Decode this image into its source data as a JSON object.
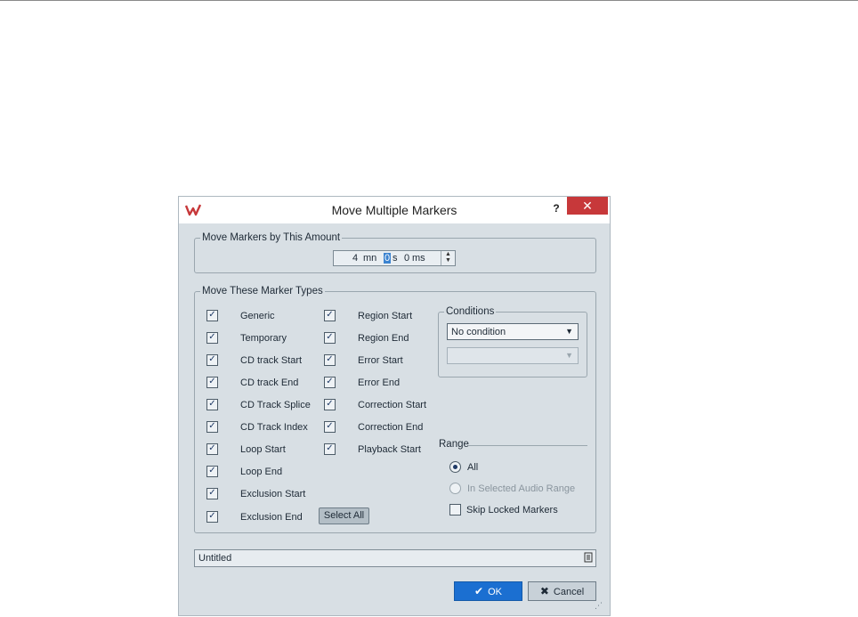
{
  "window": {
    "title": "Move Multiple Markers",
    "help": "?",
    "close": "✕"
  },
  "amount": {
    "legend": "Move Markers by This Amount",
    "minutes": "4",
    "minutes_unit": "mn",
    "seconds": "0",
    "seconds_unit": "s",
    "ms": "0",
    "ms_unit": "ms"
  },
  "types": {
    "legend": "Move These Marker Types",
    "col1": [
      {
        "label": "Generic",
        "checked": true
      },
      {
        "label": "Temporary",
        "checked": true
      },
      {
        "label": "CD track Start",
        "checked": true
      },
      {
        "label": "CD track End",
        "checked": true
      },
      {
        "label": "CD Track Splice",
        "checked": true
      },
      {
        "label": "CD Track Index",
        "checked": true
      },
      {
        "label": "Loop Start",
        "checked": true
      },
      {
        "label": "Loop End",
        "checked": true
      },
      {
        "label": "Exclusion Start",
        "checked": true
      },
      {
        "label": "Exclusion End",
        "checked": true
      }
    ],
    "col2": [
      {
        "label": "Region Start",
        "checked": true
      },
      {
        "label": "Region End",
        "checked": true
      },
      {
        "label": "Error Start",
        "checked": true
      },
      {
        "label": "Error End",
        "checked": true
      },
      {
        "label": "Correction Start",
        "checked": true
      },
      {
        "label": "Correction End",
        "checked": true
      },
      {
        "label": "Playback Start",
        "checked": true
      }
    ],
    "select_all": "Select All",
    "check_glyph": "✓"
  },
  "conditions": {
    "legend": "Conditions",
    "selected": "No condition",
    "second_value": "",
    "arrow": "▼"
  },
  "range": {
    "label": "Range",
    "options": [
      {
        "label": "All",
        "selected": true,
        "enabled": true
      },
      {
        "label": "In Selected Audio Range",
        "selected": false,
        "enabled": false
      }
    ],
    "skip_locked": {
      "label": "Skip Locked Markers",
      "checked": false
    }
  },
  "preset": {
    "value": "Untitled"
  },
  "buttons": {
    "ok": "OK",
    "cancel": "Cancel"
  },
  "colors": {
    "accent": "#1b6fd1",
    "close": "#c7383a",
    "dialog_bg": "#d8dfe4"
  }
}
